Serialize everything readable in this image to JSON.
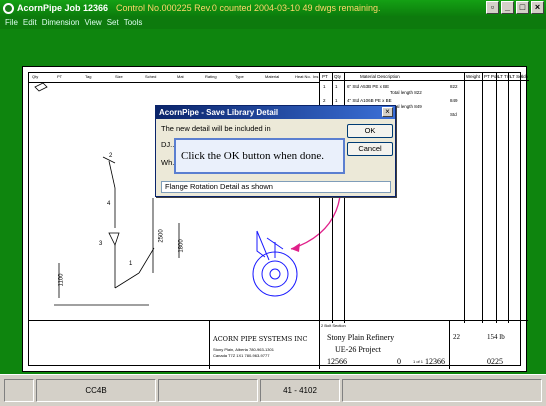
{
  "titlebar": {
    "app": "AcornPipe Job 12366",
    "info": "Control No.000225 Rev.0 counted 2004-03-10  49 dwgs remaining."
  },
  "menu": [
    "File",
    "Edit",
    "Dimension",
    "View",
    "Set",
    "Tools"
  ],
  "drawing": {
    "header_cells": [
      "Qty",
      "PT",
      "Tag",
      "Size",
      "Sched",
      "Mat",
      "Rating",
      "Type",
      "Material",
      "Heat No.",
      "Ins"
    ],
    "spool_labels": [
      "2",
      "4",
      "3",
      "1"
    ],
    "dims": [
      "2500",
      "1800",
      "1100"
    ],
    "table_header": [
      "PT",
      "Qty",
      "Material Description",
      "Weight",
      "PT Pos",
      "LT Tm",
      "LT Sel",
      "Sch"
    ],
    "table_rows": [
      {
        "pt": "1",
        "qty": "1",
        "desc": "6\" Std A53B PE x BE",
        "sub": "Total length  822",
        "val": "822"
      },
      {
        "pt": "2",
        "qty": "1",
        "desc": "4\" Std A106B PE x BE",
        "sub": "Total length  849",
        "val": "849"
      },
      {
        "pt": "",
        "qty": "",
        "desc": "Fittings Reducer",
        "sub": "",
        "val": "Std"
      }
    ],
    "company": "ACORN PIPE SYSTEMS INC",
    "address": "Stony Plain, Alberta  780-963-1301",
    "address2": "Canada T7Z 1X1   780-963-9777",
    "client": "Stony Plain Refinery",
    "project": "UE-26 Project",
    "job_no": "12566",
    "rev": "0",
    "sheet": "1 of 1",
    "job_no2": "12366",
    "control": "0225",
    "qty_field": "22",
    "weight": "154 lb",
    "small_note": "2 Bolt Section"
  },
  "dialog": {
    "title": "AcornPipe - Save Library Detail",
    "line1": "The new detail will be included in",
    "line2": "DJ...",
    "line3": "Wh...",
    "ok": "OK",
    "cancel": "Cancel",
    "input_value": "Flange Rotation Detail as shown"
  },
  "hint": "Click the OK button when done.",
  "status": {
    "left": "CC4B",
    "center": "41 - 4102"
  }
}
